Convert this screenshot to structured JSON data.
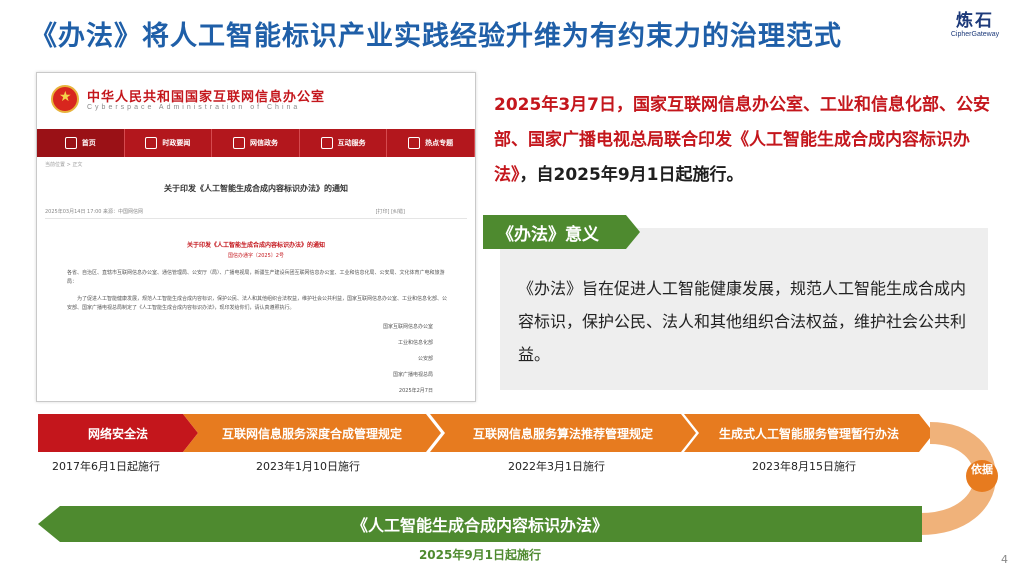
{
  "slide": {
    "title": "《办法》将人工智能标识产业实践经验升维为有约束力的治理范式",
    "logo_cn": "炼石",
    "logo_en": "CipherGateway",
    "page_number": "4"
  },
  "screenshot": {
    "org_cn": "中华人民共和国国家互联网信息办公室",
    "org_en": "Cyberspace Administration of China",
    "nav": [
      "首页",
      "时政要闻",
      "网信政务",
      "互动服务",
      "热点专题"
    ],
    "breadcrumb": "当前位置 > 正文",
    "doc_title": "关于印发《人工智能生成合成内容标识办法》的通知",
    "meta_left": "2025年03月14日 17:00  来源：中国网信网",
    "meta_right": "[打印]  [纠错]",
    "sub_title": "关于印发《人工智能生成合成内容标识办法》的通知",
    "doc_no": "国信办通字〔2025〕2号",
    "para1": "各省、自治区、直辖市互联网信息办公室、通信管理局、公安厅（局）、广播电视局，新疆生产建设兵团互联网信息办公室、工业和信息化局、公安局、文化体育广电和旅游局：",
    "para2": "为了促进人工智能健康发展，规范人工智能生成合成内容标识，保护公民、法人和其他组织合法权益，维护社会公共利益，国家互联网信息办公室、工业和信息化部、公安部、国家广播电视总局制定了《人工智能生成合成内容标识办法》，现印发给你们，请认真遵照执行。",
    "signers": [
      "国家互联网信息办公室",
      "工业和信息化部",
      "公安部",
      "国家广播电视总局"
    ],
    "sign_date": "2025年2月7日"
  },
  "headline": {
    "red_part": "2025年3月7日，国家互联网信息办公室、工业和信息化部、公安部、国家广播电视总局联合印发《人工智能生成合成内容标识办法》",
    "black_part": "，自2025年9月1日起施行。"
  },
  "significance": {
    "tab": "《办法》意义",
    "text": "《办法》旨在促进人工智能健康发展，规范人工智能生成合成内容标识，保护公民、法人和其他组织合法权益，维护社会公共利益。"
  },
  "timeline": {
    "steps": [
      {
        "label": "网络安全法",
        "date": "2017年6月1日起施行"
      },
      {
        "label": "互联网信息服务深度合成管理规定",
        "date": "2023年1月10日施行"
      },
      {
        "label": "互联网信息服务算法推荐管理规定",
        "date": "2022年3月1日施行"
      },
      {
        "label": "生成式人工智能服务管理暂行办法",
        "date": "2023年8月15日施行"
      }
    ],
    "basis": "依据",
    "final_label": "《人工智能生成合成内容标识办法》",
    "final_date": "2025年9月1日起施行"
  },
  "colors": {
    "title_blue": "#1f5fa8",
    "red": "#c4161c",
    "orange": "#e77b1f",
    "green": "#4e8a2f"
  }
}
